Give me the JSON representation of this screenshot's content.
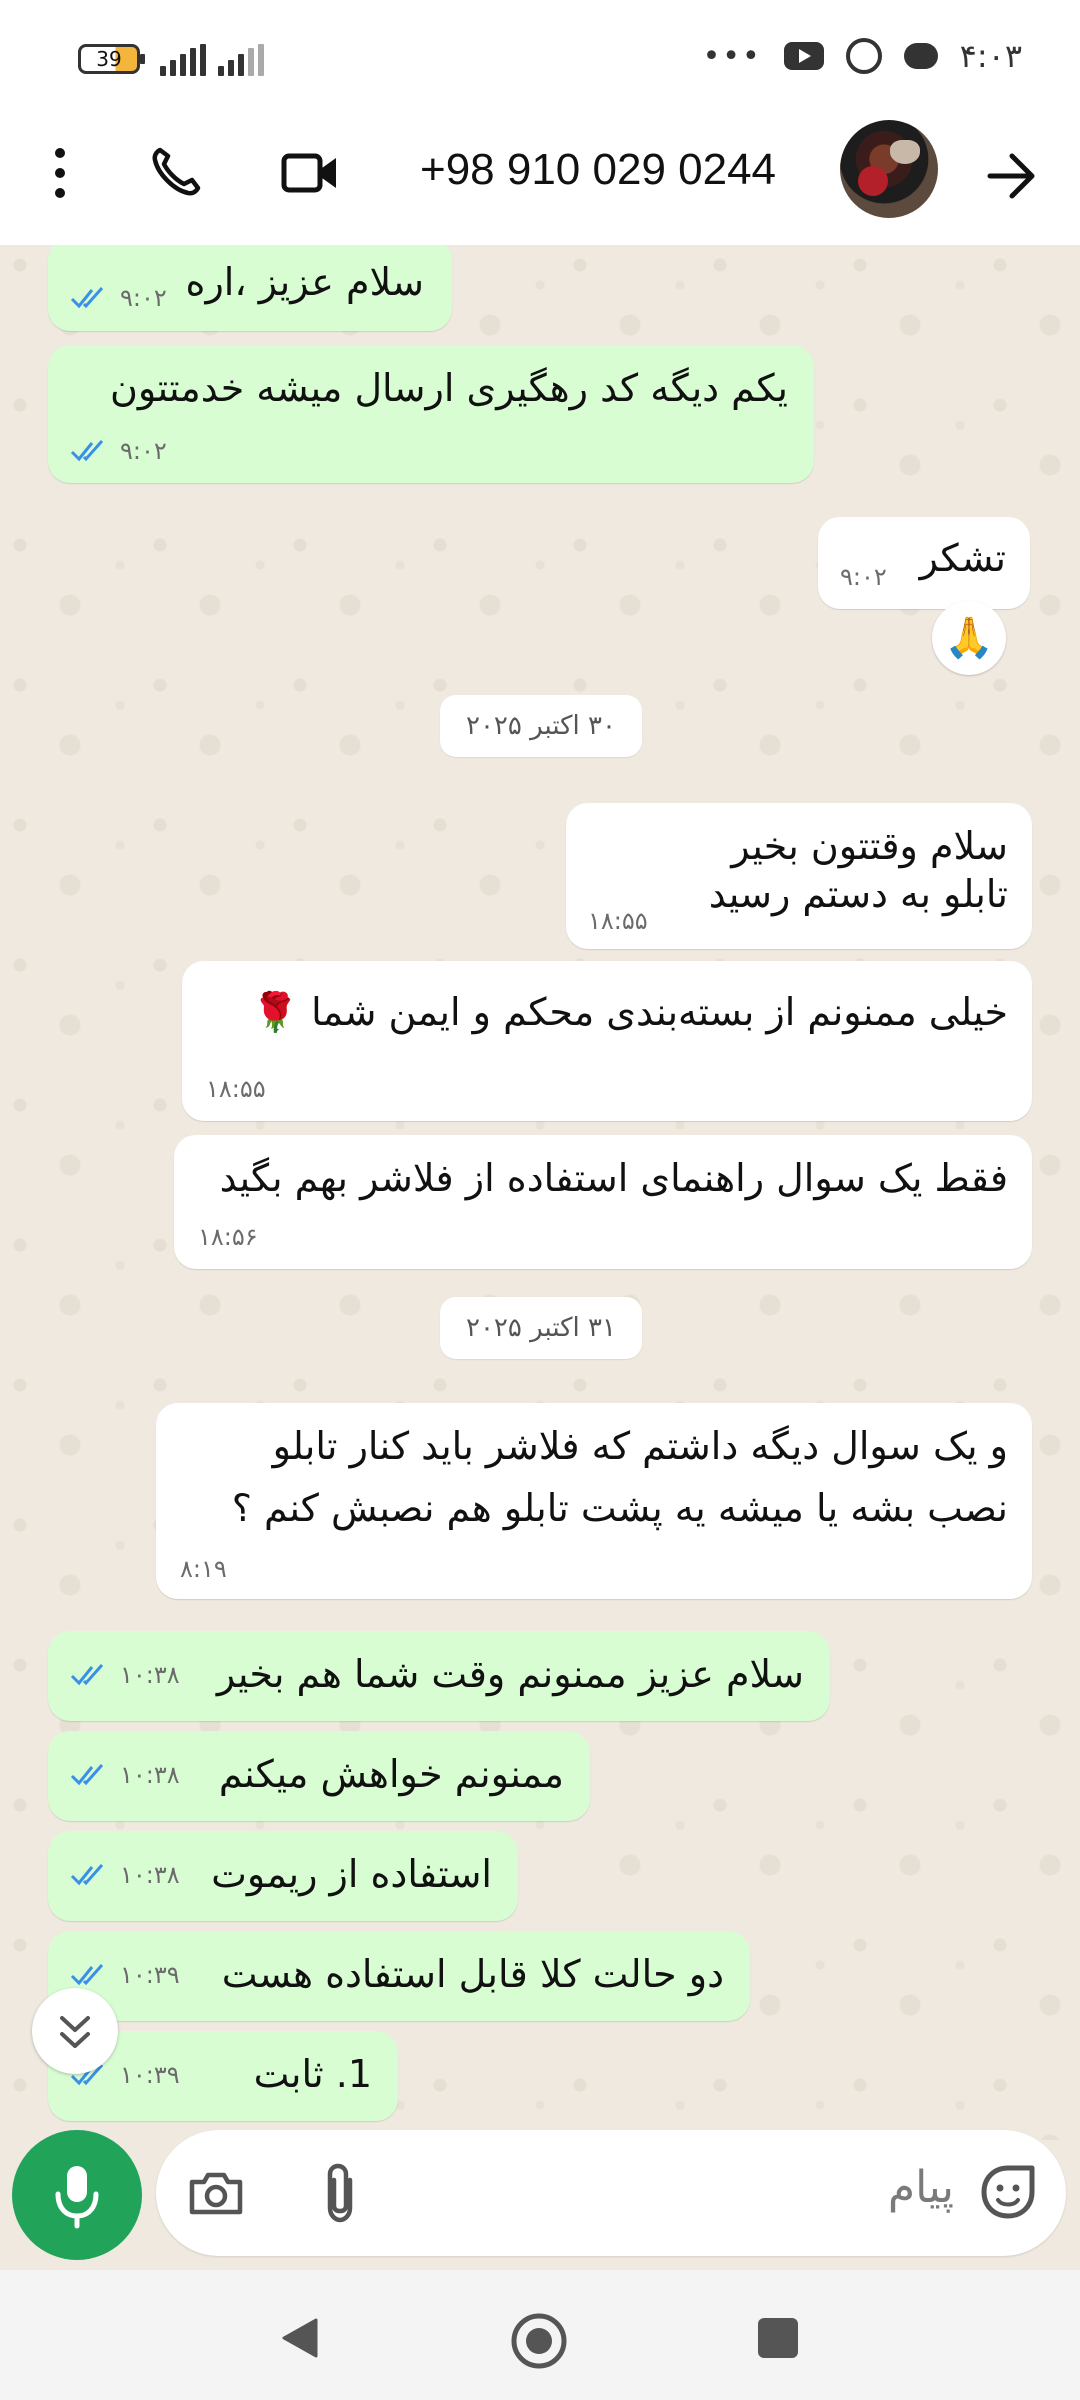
{
  "status_bar": {
    "time": "۴:۰۳",
    "battery": "39",
    "overflow": "•••",
    "icons": [
      "youtube-icon",
      "whatsapp-icon",
      "message-icon",
      "signal-icon",
      "signal-icon",
      "battery-icon"
    ]
  },
  "header": {
    "contact_name": "+98 910 029 0244",
    "icons": [
      "back-arrow-icon",
      "avatar",
      "video-call-icon",
      "phone-icon",
      "more-vert-icon"
    ]
  },
  "messages": [
    {
      "dir": "out",
      "lines": [
        "سلام عزیز ،اره"
      ],
      "time": "۹:۰۲",
      "status": "read"
    },
    {
      "dir": "out",
      "lines": [
        "یکم دیگه کد رهگیری ارسال میشه خدمتتون"
      ],
      "time": "۹:۰۲",
      "status": "read"
    },
    {
      "dir": "in",
      "lines": [
        "تشکر"
      ],
      "time": "۹:۰۲",
      "reaction": "🙏"
    },
    {
      "type": "date",
      "label": "۳۰ اکتبر ۲۰۲۵"
    },
    {
      "dir": "in",
      "lines": [
        "سلام وقتتون بخیر",
        "تابلو به دستم رسید"
      ],
      "time": "۱۸:۵۵"
    },
    {
      "dir": "in",
      "lines": [
        "خیلی ممنونم از بسته‌بندی محکم و ایمن شما 🌹"
      ],
      "time": "۱۸:۵۵"
    },
    {
      "dir": "in",
      "lines": [
        "فقط یک سوال راهنمای استفاده از فلاشر بهم بگید"
      ],
      "time": "۱۸:۵۶"
    },
    {
      "type": "date",
      "label": "۳۱ اکتبر ۲۰۲۵"
    },
    {
      "dir": "in",
      "lines": [
        "و یک سوال دیگه داشتم که فلاشر باید کنار تابلو",
        "نصب بشه یا میشه یه پشت تابلو هم نصبش کنم ؟"
      ],
      "time": "۸:۱۹"
    },
    {
      "dir": "out",
      "lines": [
        "سلام عزیز ممنونم وقت شما هم بخیر"
      ],
      "time": "۱۰:۳۸",
      "status": "read"
    },
    {
      "dir": "out",
      "lines": [
        "ممنونم خواهش میکنم"
      ],
      "time": "۱۰:۳۸",
      "status": "read"
    },
    {
      "dir": "out",
      "lines": [
        "استفاده از ریموت"
      ],
      "time": "۱۰:۳۸",
      "status": "read"
    },
    {
      "dir": "out",
      "lines": [
        "دو حالت کلا قابل استفاده هست"
      ],
      "time": "۱۰:۳۹",
      "status": "read"
    },
    {
      "dir": "out",
      "lines": [
        "1. ثابت"
      ],
      "time": "۱۰:۳۹",
      "status": "read"
    }
  ],
  "composer": {
    "placeholder": "پیام",
    "icons": [
      "sticker-icon",
      "attach-icon",
      "camera-icon",
      "mic-icon"
    ]
  },
  "nav_bar": {
    "icons": [
      "nav-back-icon",
      "nav-home-icon",
      "nav-recents-icon"
    ]
  },
  "colors": {
    "outgoing_bubble": "#d9fdd3",
    "incoming_bubble": "#ffffff",
    "chat_background": "#efe9df",
    "read_ticks": "#3a8fe8",
    "mic_button": "#21a35a"
  }
}
